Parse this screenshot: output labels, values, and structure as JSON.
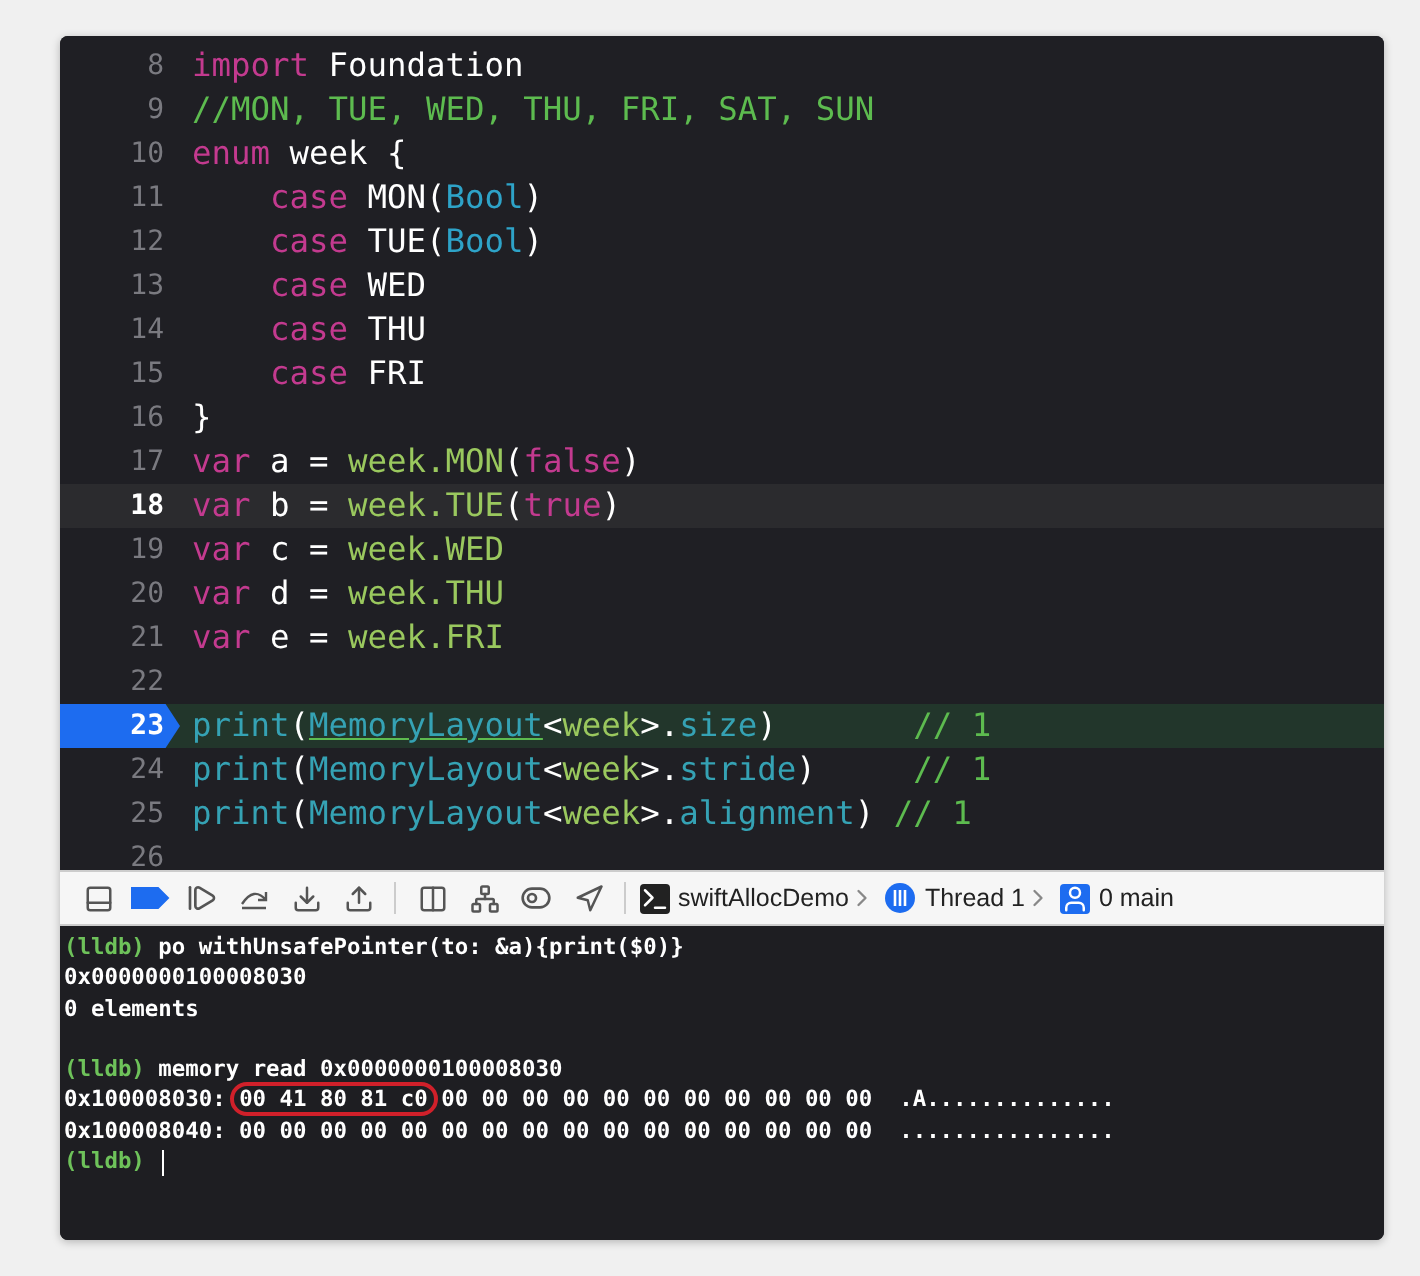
{
  "editor": {
    "lines": [
      {
        "number": "8",
        "tokens": [
          {
            "t": "import",
            "kind": "keyword"
          },
          {
            "t": " Foundation",
            "kind": "plain"
          }
        ]
      },
      {
        "number": "9",
        "tokens": [
          {
            "t": "//MON, TUE, WED, THU, FRI, SAT, SUN",
            "kind": "comment"
          }
        ]
      },
      {
        "number": "10",
        "tokens": [
          {
            "t": "enum",
            "kind": "keyword"
          },
          {
            "t": " week {",
            "kind": "plain"
          }
        ]
      },
      {
        "number": "11",
        "tokens": [
          {
            "t": "    case",
            "kind": "keyword"
          },
          {
            "t": " MON(",
            "kind": "plain"
          },
          {
            "t": "Bool",
            "kind": "type"
          },
          {
            "t": ")",
            "kind": "plain"
          }
        ]
      },
      {
        "number": "12",
        "tokens": [
          {
            "t": "    case",
            "kind": "keyword"
          },
          {
            "t": " TUE(",
            "kind": "plain"
          },
          {
            "t": "Bool",
            "kind": "type"
          },
          {
            "t": ")",
            "kind": "plain"
          }
        ]
      },
      {
        "number": "13",
        "tokens": [
          {
            "t": "    case",
            "kind": "keyword"
          },
          {
            "t": " WED",
            "kind": "plain"
          }
        ]
      },
      {
        "number": "14",
        "tokens": [
          {
            "t": "    case",
            "kind": "keyword"
          },
          {
            "t": " THU",
            "kind": "plain"
          }
        ]
      },
      {
        "number": "15",
        "tokens": [
          {
            "t": "    case",
            "kind": "keyword"
          },
          {
            "t": " FRI",
            "kind": "plain"
          }
        ]
      },
      {
        "number": "16",
        "tokens": [
          {
            "t": "}",
            "kind": "plain"
          }
        ]
      },
      {
        "number": "17",
        "tokens": [
          {
            "t": "var",
            "kind": "keyword"
          },
          {
            "t": " a = ",
            "kind": "plain"
          },
          {
            "t": "week.MON",
            "kind": "member"
          },
          {
            "t": "(",
            "kind": "plain"
          },
          {
            "t": "false",
            "kind": "keyword"
          },
          {
            "t": ")",
            "kind": "plain"
          }
        ]
      },
      {
        "number": "18",
        "current": true,
        "tokens": [
          {
            "t": "var",
            "kind": "keyword"
          },
          {
            "t": " b = ",
            "kind": "plain"
          },
          {
            "t": "week.TUE",
            "kind": "member"
          },
          {
            "t": "(",
            "kind": "plain"
          },
          {
            "t": "true",
            "kind": "keyword"
          },
          {
            "t": ")",
            "kind": "plain"
          }
        ]
      },
      {
        "number": "19",
        "tokens": [
          {
            "t": "var",
            "kind": "keyword"
          },
          {
            "t": " c = ",
            "kind": "plain"
          },
          {
            "t": "week.WED",
            "kind": "member"
          }
        ]
      },
      {
        "number": "20",
        "tokens": [
          {
            "t": "var",
            "kind": "keyword"
          },
          {
            "t": " d = ",
            "kind": "plain"
          },
          {
            "t": "week.THU",
            "kind": "member"
          }
        ]
      },
      {
        "number": "21",
        "tokens": [
          {
            "t": "var",
            "kind": "keyword"
          },
          {
            "t": " e = ",
            "kind": "plain"
          },
          {
            "t": "week.FRI",
            "kind": "member"
          }
        ]
      },
      {
        "number": "22"
      },
      {
        "number": "23",
        "breakpoint": true,
        "executing": true,
        "tokens": [
          {
            "t": "print",
            "kind": "func"
          },
          {
            "t": "(",
            "kind": "plain"
          },
          {
            "t": "MemoryLayout",
            "kind": "func",
            "underlined": true
          },
          {
            "t": "<",
            "kind": "plain"
          },
          {
            "t": "week",
            "kind": "member"
          },
          {
            "t": ">.",
            "kind": "plain"
          },
          {
            "t": "size",
            "kind": "func"
          },
          {
            "t": ")       ",
            "kind": "plain"
          },
          {
            "t": "// 1",
            "kind": "comment"
          }
        ]
      },
      {
        "number": "24",
        "tokens": [
          {
            "t": "print",
            "kind": "func"
          },
          {
            "t": "(",
            "kind": "plain"
          },
          {
            "t": "MemoryLayout",
            "kind": "func"
          },
          {
            "t": "<",
            "kind": "plain"
          },
          {
            "t": "week",
            "kind": "member"
          },
          {
            "t": ">.",
            "kind": "plain"
          },
          {
            "t": "stride",
            "kind": "func"
          },
          {
            "t": ")     ",
            "kind": "plain"
          },
          {
            "t": "// 1",
            "kind": "comment"
          }
        ]
      },
      {
        "number": "25",
        "tokens": [
          {
            "t": "print",
            "kind": "func"
          },
          {
            "t": "(",
            "kind": "plain"
          },
          {
            "t": "MemoryLayout",
            "kind": "func"
          },
          {
            "t": "<",
            "kind": "plain"
          },
          {
            "t": "week",
            "kind": "member"
          },
          {
            "t": ">.",
            "kind": "plain"
          },
          {
            "t": "alignment",
            "kind": "func"
          },
          {
            "t": ") ",
            "kind": "plain"
          },
          {
            "t": "// 1",
            "kind": "comment"
          }
        ]
      },
      {
        "number": "26"
      }
    ]
  },
  "debug_bar": {
    "breakpoints_active": true,
    "path": [
      {
        "kind": "target",
        "label": "swiftAllocDemo"
      },
      {
        "kind": "thread",
        "label": "Thread 1"
      },
      {
        "kind": "frame",
        "label": "0 main"
      }
    ]
  },
  "console": {
    "lines": [
      {
        "prompt": "(lldb)",
        "segments": [
          {
            "t": "po withUnsafePointer(to: &a){print($0)}"
          }
        ]
      },
      {
        "segments": [
          {
            "t": "0x0000000100008030"
          }
        ]
      },
      {
        "segments": [
          {
            "t": "0 elements"
          }
        ]
      },
      {
        "prompt": "(lldb)",
        "gap_before": true,
        "segments": [
          {
            "t": "memory read 0x0000000100008030"
          }
        ]
      },
      {
        "segments": [
          {
            "t": "0x100008030: "
          },
          {
            "t": "00 41 80 81 c0",
            "circled": true
          },
          {
            "t": " 00 00 00 00 00 00 00 00 00 00 00  .A.............."
          }
        ]
      },
      {
        "segments": [
          {
            "t": "0x100008040: 00 00 00 00 00 00 00 00 00 00 00 00 00 00 00 00  ................"
          }
        ]
      },
      {
        "prompt": "(lldb)",
        "cursor": true
      }
    ]
  }
}
